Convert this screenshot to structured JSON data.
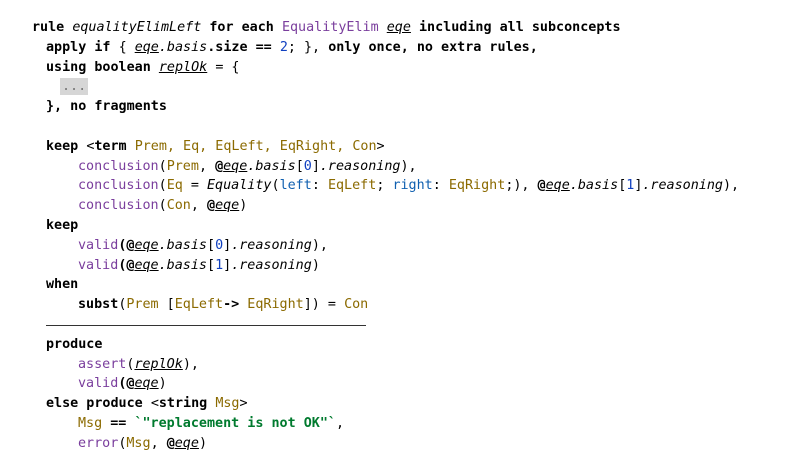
{
  "header": {
    "rule_kw": "rule",
    "rule_name": "equalityElimLeft",
    "for_each_kw": "for each",
    "concept": "EqualityElim",
    "var": "eqe",
    "including_kw": "including all subconcepts",
    "apply_kw": "apply if",
    "open_brace": "{",
    "cond_var": "eqe",
    "cond_basis": ".basis",
    "cond_size": ".size",
    "cond_op": "==",
    "cond_num": "2",
    "cond_end": "; },",
    "only_once": "only once, no extra rules,",
    "using_kw": "using",
    "boolean_kw": "boolean",
    "using_var": "replOk",
    "using_assign": "= {",
    "ellipsis": "...",
    "close_fragments": "}, no fragments"
  },
  "keep1": {
    "keep_kw": "keep",
    "term_open": "<",
    "term_kw": "term",
    "params": "Prem, Eq, EqLeft, EqRight, Con",
    "term_close": ">",
    "c1_fn": "conclusion",
    "c1_open": "(",
    "c1_param": "Prem",
    "c1_sep": ", ",
    "c1_at": "@",
    "c1_var": "eqe",
    "c1_basis": ".basis",
    "c1_idx_open": "[",
    "c1_idx": "0",
    "c1_idx_close": "]",
    "c1_reasoning": ".reasoning",
    "c1_close": "),",
    "c2_fn": "conclusion",
    "c2_open": "(",
    "c2_param": "Eq",
    "c2_eq": " = ",
    "c2_cls": "Equality",
    "c2_po": "(",
    "c2_left_kw": "left",
    "c2_colon1": ": ",
    "c2_left_val": "EqLeft",
    "c2_semi1": "; ",
    "c2_right_kw": "right",
    "c2_colon2": ": ",
    "c2_right_val": "EqRight",
    "c2_semi2": ";),",
    "c2_at": " @",
    "c2_var": "eqe",
    "c2_basis": ".basis",
    "c2_idx_open": "[",
    "c2_idx": "1",
    "c2_idx_close": "]",
    "c2_reasoning": ".reasoning",
    "c2_close": "),",
    "c3_fn": "conclusion",
    "c3_open": "(",
    "c3_param": "Con",
    "c3_sep": ", ",
    "c3_at": "@",
    "c3_var": "eqe",
    "c3_close": ")"
  },
  "keep2": {
    "keep_kw": "keep",
    "v1_fn": "valid",
    "v1_open": "(@",
    "v1_var": "eqe",
    "v1_basis": ".basis",
    "v1_idx_open": "[",
    "v1_idx": "0",
    "v1_idx_close": "]",
    "v1_reasoning": ".reasoning",
    "v1_close": "),",
    "v2_fn": "valid",
    "v2_open": "(@",
    "v2_var": "eqe",
    "v2_basis": ".basis",
    "v2_idx_open": "[",
    "v2_idx": "1",
    "v2_idx_close": "]",
    "v2_reasoning": ".reasoning",
    "v2_close": ")"
  },
  "when": {
    "when_kw": "when",
    "subst_kw": "subst",
    "open": "(",
    "prem": "Prem",
    "bracket_open": " [",
    "left": "EqLeft",
    "arrow": "->",
    "right": " EqRight",
    "bracket_close": "])",
    "eq": " = ",
    "con": "Con"
  },
  "produce": {
    "produce_kw": "produce",
    "assert_fn": "assert",
    "assert_open": "(",
    "assert_var": "replOk",
    "assert_close": "),",
    "valid_fn": "valid",
    "valid_open": "(@",
    "valid_var": "eqe",
    "valid_close": ")",
    "else_kw": "else produce",
    "str_open": "<",
    "string_kw": "string",
    "msg_param": "Msg",
    "str_close": ">",
    "msg_lhs": "Msg",
    "msg_op": "==",
    "msg_str": "`\"replacement is not OK\"`",
    "msg_end": ",",
    "error_fn": "error",
    "error_open": "(",
    "error_param": "Msg",
    "error_sep": ", ",
    "error_at": "@",
    "error_var": "eqe",
    "error_close": ")"
  }
}
